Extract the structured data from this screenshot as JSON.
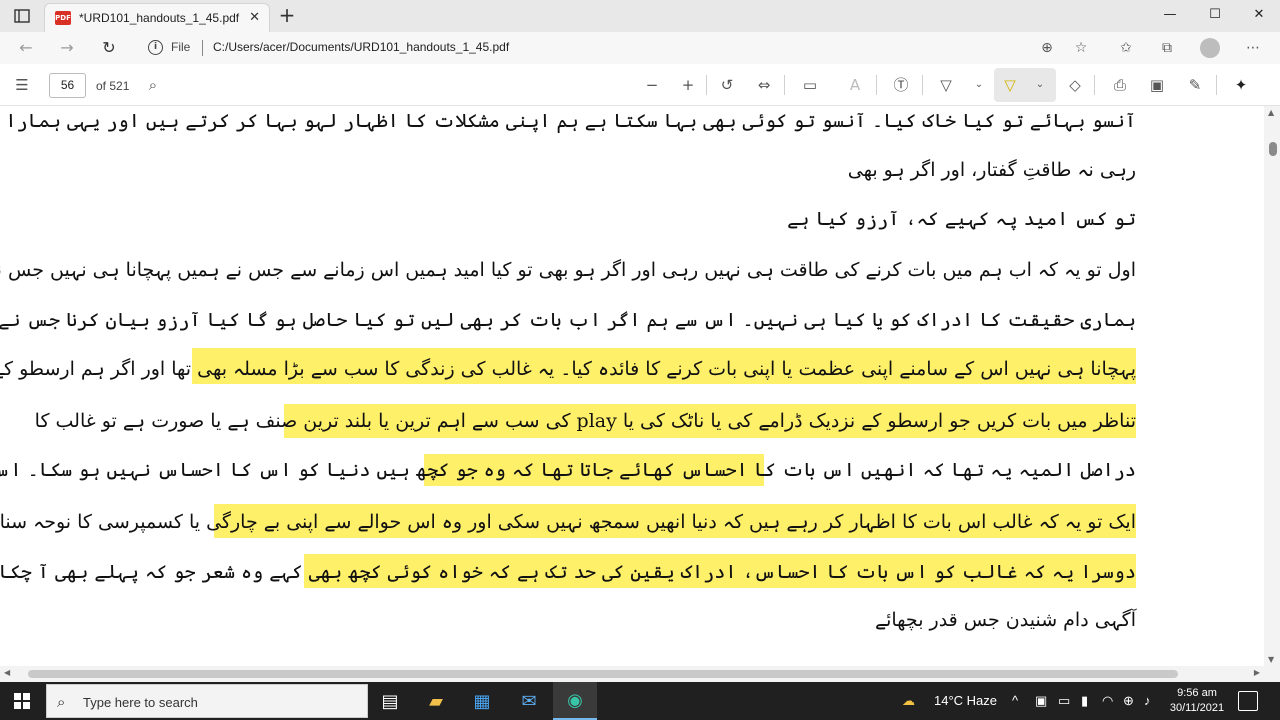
{
  "tab": {
    "title": "*URD101_handouts_1_45.pdf",
    "close": "✕",
    "new": "+"
  },
  "window_controls": {
    "minimize": "—",
    "maximize": "☐",
    "close": "✕"
  },
  "address": {
    "file_label": "File",
    "url": "C:/Users/acer/Documents/URD101_handouts_1_45.pdf"
  },
  "pdf_toolbar": {
    "page_number": "56",
    "page_count": "of 521"
  },
  "document": {
    "lines": [
      "آنسو بہائے تو کیا خاک کیا۔ آنسو تو کوئی بھی بہا سکتا ہے ہم اپنی مشکلات کا اظہار لہو بہا کر کرتے ہیں اور یہی ہمارا افتخار اور ہمارا امتیاز ہے۔",
      "رہی نہ طاقتِ گفتار، اور اگر ہو بھی",
      "تو کس امید پہ کہیے کہ، آرزو کیا ہے",
      "اول تو یہ کہ اب ہم میں بات کرنے کی طاقت ہی نہیں رہی اور اگر ہو بھی تو کیا امید ہمیں اس زمانے سے جس نے ہمیں پہچانا ہی نہیں جس نے",
      "ہماری حقیقت کا ادراک کو یا کیا ہی نہیں۔ اس سے ہم اگر اب بات کر بھی لیں تو کیا حاصل ہو گا کیا آرزو بیان کرنا جس نے ہمیں مانا ہی نہیں ہمیں",
      "پہچانا ہی نہیں اس کے سامنے اپنی عظمت یا اپنی بات کرنے کا فائدہ کیا۔ یہ غالب کی زندگی کا سب سے بڑا مسلہ بھی تھا اور اگر ہم ارسطو کے ایلیے کے",
      "تناظر میں بات کریں جو ارسطو کے نزدیک ڈرامے کی یا ناٹک کی یا play کی سب سے اہم ترین یا بلند ترین صنف ہے یا صورت ہے تو غالب کا",
      "دراصل المیہ یہ تھا کہ انھیں اس بات کا احساس کھائے جاتا تھا کہ وہ جو کچھ ہیں دنیا کو اس کا احساس نہیں ہو سکا۔ اس سے ہم دو باتیں اخذ کر سکتے ہیں",
      "ایک تو یہ کہ غالب اس بات کا اظہار کر رہے ہیں کہ دنیا انھیں سمجھ نہیں سکی اور وہ اس حوالے سے اپنی بے چارگی یا کسمپرسی کا نوحہ سنا رہے ہیں اور",
      "دوسرا یہ کہ غالب کو اس بات کا احساس، ادراک یقین کی حد تک ہے کہ خواہ کوئی کچھ بھی کہے وہ شعر جو کہ پہلے بھی آ چکا ہے۔",
      "آگہی دام شنیدن جس قدر بچھائے"
    ]
  },
  "taskbar": {
    "search_placeholder": "Type here to search",
    "weather": "14°C  Haze",
    "time": "9:56 am",
    "date": "30/11/2021"
  },
  "colors": {
    "highlight": "#fff06a",
    "taskbar": "#202020",
    "accent": "#76b9ed"
  }
}
